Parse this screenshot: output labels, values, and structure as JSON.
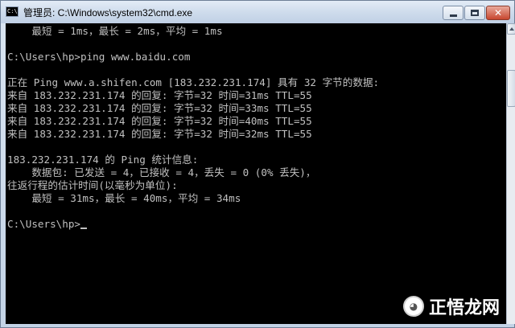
{
  "window": {
    "title": "管理员: C:\\Windows\\system32\\cmd.exe",
    "icon_text": "C:\\",
    "icon": "cmd-icon"
  },
  "console": {
    "lines": [
      "    最短 = 1ms，最长 = 2ms，平均 = 1ms",
      "",
      "C:\\Users\\hp>ping www.baidu.com",
      "",
      "正在 Ping www.a.shifen.com [183.232.231.174] 具有 32 字节的数据:",
      "来自 183.232.231.174 的回复: 字节=32 时间=31ms TTL=55",
      "来自 183.232.231.174 的回复: 字节=32 时间=33ms TTL=55",
      "来自 183.232.231.174 的回复: 字节=32 时间=40ms TTL=55",
      "来自 183.232.231.174 的回复: 字节=32 时间=32ms TTL=55",
      "",
      "183.232.231.174 的 Ping 统计信息:",
      "    数据包: 已发送 = 4，已接收 = 4，丢失 = 0 (0% 丢失)，",
      "往返行程的估计时间(以毫秒为单位):",
      "    最短 = 31ms，最长 = 40ms，平均 = 34ms",
      "",
      "C:\\Users\\hp>"
    ]
  },
  "watermark": {
    "text": "正悟龙网"
  },
  "colors": {
    "console_bg": "#000000",
    "console_fg": "#c0c0c0",
    "titlebar": "#cfdcec",
    "close_button": "#c8472f"
  }
}
